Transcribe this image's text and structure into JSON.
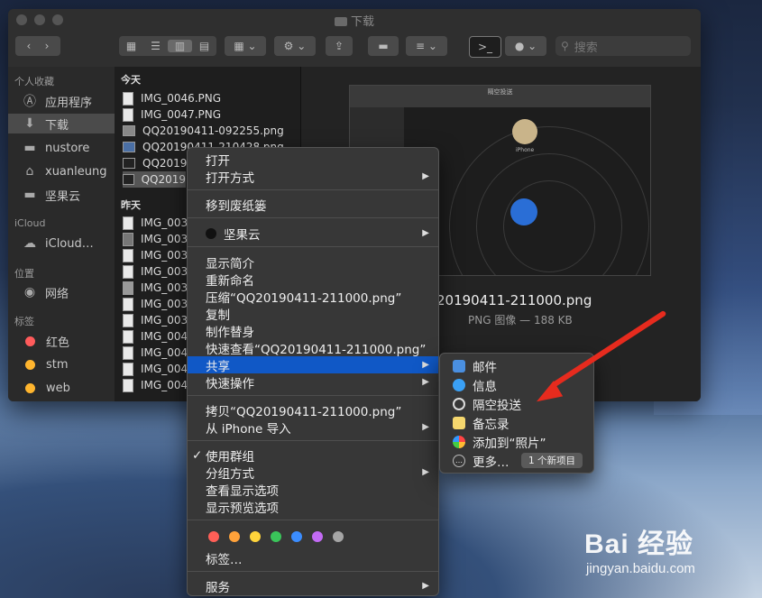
{
  "window": {
    "title": "下载",
    "search_placeholder": "搜索"
  },
  "sidebar": {
    "favorites_header": "个人收藏",
    "favorites": [
      {
        "label": "应用程序",
        "icon": "apps-icon"
      },
      {
        "label": "下载",
        "icon": "download-icon"
      },
      {
        "label": "nustore",
        "icon": "folder-icon"
      },
      {
        "label": "xuanleung",
        "icon": "home-icon"
      },
      {
        "label": "坚果云",
        "icon": "folder-icon"
      }
    ],
    "icloud_header": "iCloud",
    "icloud_item": "iCloud…",
    "locations_header": "位置",
    "network": "网络",
    "tags_header": "标签",
    "tags": [
      {
        "label": "红色",
        "color": "#ff5b5b"
      },
      {
        "label": "stm",
        "color": "#ffb52e"
      },
      {
        "label": "web",
        "color": "#ffb52e"
      }
    ]
  },
  "files": {
    "today_header": "今天",
    "today": [
      "IMG_0046.PNG",
      "IMG_0047.PNG",
      "QQ20190411-092255.png",
      "QQ20190411-210428.png",
      "QQ2019",
      "QQ2019"
    ],
    "yesterday_header": "昨天",
    "yesterday": [
      "IMG_003",
      "IMG_003",
      "IMG_003",
      "IMG_003",
      "IMG_003",
      "IMG_003",
      "IMG_003",
      "IMG_004",
      "IMG_004",
      "IMG_004",
      "IMG_004"
    ]
  },
  "preview": {
    "screenshot_title": "隔空投送",
    "device_label": "iPhone",
    "filename": "20190411-211000.png",
    "info": "PNG 图像 — 188 KB"
  },
  "context_menu": {
    "items": [
      "打开",
      "打开方式",
      "移到废纸篓",
      "坚果云",
      "显示简介",
      "重新命名",
      "压缩“QQ20190411-211000.png”",
      "复制",
      "制作替身",
      "快速查看“QQ20190411-211000.png”",
      "共享",
      "快速操作",
      "拷贝“QQ20190411-211000.png”",
      "从 iPhone 导入",
      "使用群组",
      "分组方式",
      "查看显示选项",
      "显示预览选项",
      "标签…",
      "服务"
    ],
    "checkmark": "✓",
    "tag_colors": [
      "#ff5f57",
      "#ffa23a",
      "#ffd43b",
      "#3ac55a",
      "#3b8dff",
      "#c36bf5",
      "#a5a5a5"
    ]
  },
  "share_menu": {
    "items": [
      "邮件",
      "信息",
      "隔空投送",
      "备忘录",
      "添加到“照片”",
      "更多…"
    ],
    "badge": "1 个新项目"
  },
  "watermark": {
    "brand": "Bai  经验",
    "url": "jingyan.baidu.com"
  }
}
